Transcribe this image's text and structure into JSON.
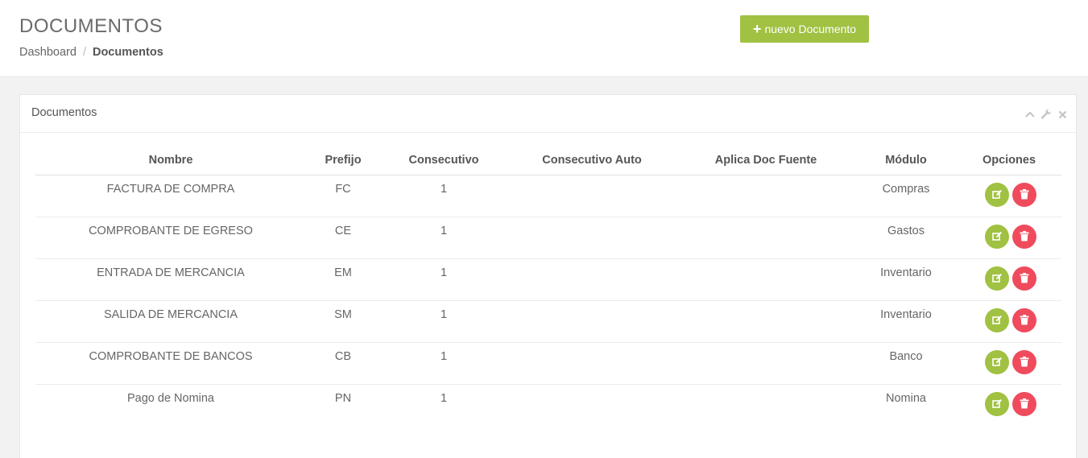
{
  "header": {
    "title": "DOCUMENTOS",
    "breadcrumb": {
      "home": "Dashboard",
      "separator": "/",
      "current": "Documentos"
    },
    "new_button_label": "nuevo Documento"
  },
  "panel": {
    "title": "Documentos",
    "tools": [
      "chevron-up-icon",
      "wrench-icon",
      "close-icon"
    ]
  },
  "table": {
    "columns": [
      "Nombre",
      "Prefijo",
      "Consecutivo",
      "Consecutivo Auto",
      "Aplica Doc Fuente",
      "Módulo",
      "Opciones"
    ],
    "rows": [
      {
        "nombre": "FACTURA DE COMPRA",
        "prefijo": "FC",
        "consecutivo": "1",
        "consecutivo_auto": "",
        "aplica": "",
        "modulo": "Compras"
      },
      {
        "nombre": "COMPROBANTE DE EGRESO",
        "prefijo": "CE",
        "consecutivo": "1",
        "consecutivo_auto": "",
        "aplica": "",
        "modulo": "Gastos"
      },
      {
        "nombre": "ENTRADA DE MERCANCIA",
        "prefijo": "EM",
        "consecutivo": "1",
        "consecutivo_auto": "",
        "aplica": "",
        "modulo": "Inventario"
      },
      {
        "nombre": "SALIDA DE MERCANCIA",
        "prefijo": "SM",
        "consecutivo": "1",
        "consecutivo_auto": "",
        "aplica": "",
        "modulo": "Inventario"
      },
      {
        "nombre": "COMPROBANTE DE BANCOS",
        "prefijo": "CB",
        "consecutivo": "1",
        "consecutivo_auto": "",
        "aplica": "",
        "modulo": "Banco"
      },
      {
        "nombre": "Pago de Nomina",
        "prefijo": "PN",
        "consecutivo": "1",
        "consecutivo_auto": "",
        "aplica": "",
        "modulo": "Nomina"
      }
    ]
  },
  "colors": {
    "accent_green": "#a0c142",
    "danger_red": "#ef4b5d"
  }
}
